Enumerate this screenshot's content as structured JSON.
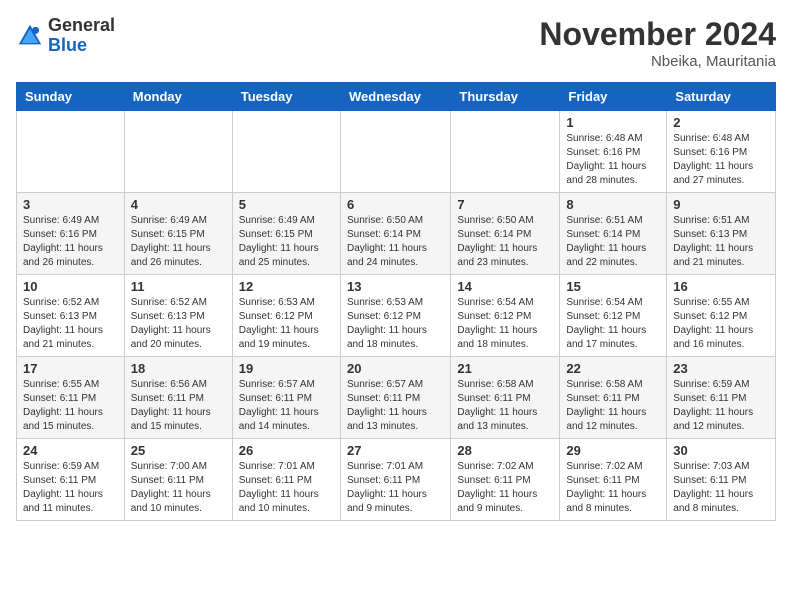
{
  "header": {
    "logo_general": "General",
    "logo_blue": "Blue",
    "month_title": "November 2024",
    "location": "Nbeika, Mauritania"
  },
  "days_of_week": [
    "Sunday",
    "Monday",
    "Tuesday",
    "Wednesday",
    "Thursday",
    "Friday",
    "Saturday"
  ],
  "weeks": [
    [
      {
        "day": "",
        "info": ""
      },
      {
        "day": "",
        "info": ""
      },
      {
        "day": "",
        "info": ""
      },
      {
        "day": "",
        "info": ""
      },
      {
        "day": "",
        "info": ""
      },
      {
        "day": "1",
        "info": "Sunrise: 6:48 AM\nSunset: 6:16 PM\nDaylight: 11 hours and 28 minutes."
      },
      {
        "day": "2",
        "info": "Sunrise: 6:48 AM\nSunset: 6:16 PM\nDaylight: 11 hours and 27 minutes."
      }
    ],
    [
      {
        "day": "3",
        "info": "Sunrise: 6:49 AM\nSunset: 6:16 PM\nDaylight: 11 hours and 26 minutes."
      },
      {
        "day": "4",
        "info": "Sunrise: 6:49 AM\nSunset: 6:15 PM\nDaylight: 11 hours and 26 minutes."
      },
      {
        "day": "5",
        "info": "Sunrise: 6:49 AM\nSunset: 6:15 PM\nDaylight: 11 hours and 25 minutes."
      },
      {
        "day": "6",
        "info": "Sunrise: 6:50 AM\nSunset: 6:14 PM\nDaylight: 11 hours and 24 minutes."
      },
      {
        "day": "7",
        "info": "Sunrise: 6:50 AM\nSunset: 6:14 PM\nDaylight: 11 hours and 23 minutes."
      },
      {
        "day": "8",
        "info": "Sunrise: 6:51 AM\nSunset: 6:14 PM\nDaylight: 11 hours and 22 minutes."
      },
      {
        "day": "9",
        "info": "Sunrise: 6:51 AM\nSunset: 6:13 PM\nDaylight: 11 hours and 21 minutes."
      }
    ],
    [
      {
        "day": "10",
        "info": "Sunrise: 6:52 AM\nSunset: 6:13 PM\nDaylight: 11 hours and 21 minutes."
      },
      {
        "day": "11",
        "info": "Sunrise: 6:52 AM\nSunset: 6:13 PM\nDaylight: 11 hours and 20 minutes."
      },
      {
        "day": "12",
        "info": "Sunrise: 6:53 AM\nSunset: 6:12 PM\nDaylight: 11 hours and 19 minutes."
      },
      {
        "day": "13",
        "info": "Sunrise: 6:53 AM\nSunset: 6:12 PM\nDaylight: 11 hours and 18 minutes."
      },
      {
        "day": "14",
        "info": "Sunrise: 6:54 AM\nSunset: 6:12 PM\nDaylight: 11 hours and 18 minutes."
      },
      {
        "day": "15",
        "info": "Sunrise: 6:54 AM\nSunset: 6:12 PM\nDaylight: 11 hours and 17 minutes."
      },
      {
        "day": "16",
        "info": "Sunrise: 6:55 AM\nSunset: 6:12 PM\nDaylight: 11 hours and 16 minutes."
      }
    ],
    [
      {
        "day": "17",
        "info": "Sunrise: 6:55 AM\nSunset: 6:11 PM\nDaylight: 11 hours and 15 minutes."
      },
      {
        "day": "18",
        "info": "Sunrise: 6:56 AM\nSunset: 6:11 PM\nDaylight: 11 hours and 15 minutes."
      },
      {
        "day": "19",
        "info": "Sunrise: 6:57 AM\nSunset: 6:11 PM\nDaylight: 11 hours and 14 minutes."
      },
      {
        "day": "20",
        "info": "Sunrise: 6:57 AM\nSunset: 6:11 PM\nDaylight: 11 hours and 13 minutes."
      },
      {
        "day": "21",
        "info": "Sunrise: 6:58 AM\nSunset: 6:11 PM\nDaylight: 11 hours and 13 minutes."
      },
      {
        "day": "22",
        "info": "Sunrise: 6:58 AM\nSunset: 6:11 PM\nDaylight: 11 hours and 12 minutes."
      },
      {
        "day": "23",
        "info": "Sunrise: 6:59 AM\nSunset: 6:11 PM\nDaylight: 11 hours and 12 minutes."
      }
    ],
    [
      {
        "day": "24",
        "info": "Sunrise: 6:59 AM\nSunset: 6:11 PM\nDaylight: 11 hours and 11 minutes."
      },
      {
        "day": "25",
        "info": "Sunrise: 7:00 AM\nSunset: 6:11 PM\nDaylight: 11 hours and 10 minutes."
      },
      {
        "day": "26",
        "info": "Sunrise: 7:01 AM\nSunset: 6:11 PM\nDaylight: 11 hours and 10 minutes."
      },
      {
        "day": "27",
        "info": "Sunrise: 7:01 AM\nSunset: 6:11 PM\nDaylight: 11 hours and 9 minutes."
      },
      {
        "day": "28",
        "info": "Sunrise: 7:02 AM\nSunset: 6:11 PM\nDaylight: 11 hours and 9 minutes."
      },
      {
        "day": "29",
        "info": "Sunrise: 7:02 AM\nSunset: 6:11 PM\nDaylight: 11 hours and 8 minutes."
      },
      {
        "day": "30",
        "info": "Sunrise: 7:03 AM\nSunset: 6:11 PM\nDaylight: 11 hours and 8 minutes."
      }
    ]
  ]
}
